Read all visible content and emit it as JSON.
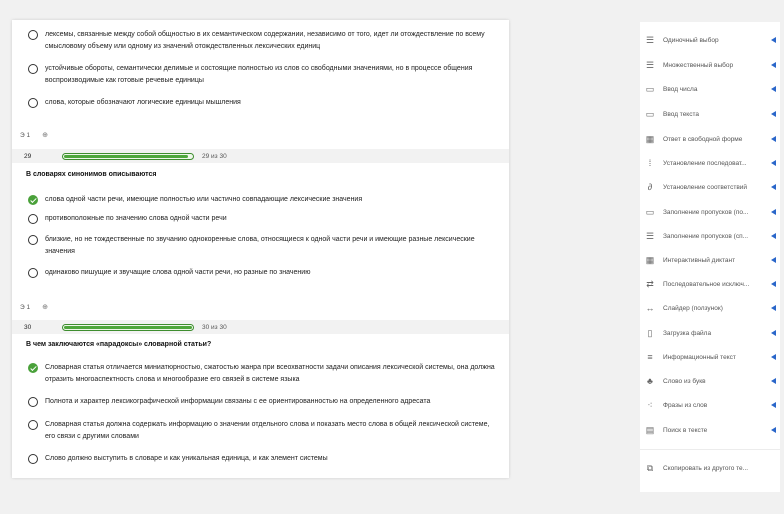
{
  "colors": {
    "accent_green": "#4ea63c",
    "arrow_blue": "#2a66c9"
  },
  "q1": {
    "options": [
      {
        "text": "лексемы, связанные между собой общностью в их семантическом содержании, независимо от того, идет ли отождествление по всему смысловому объему или одному из значений отождествленных лексических единиц",
        "checked": false
      },
      {
        "text": "устойчивые обороты, семантически делимые и состоящие полностью из слов со свободными значениями, но в процессе общения воспроизводимые как готовые речевые единицы",
        "checked": false
      },
      {
        "text": "слова, которые обозначают логические единицы мышления",
        "checked": false
      }
    ]
  },
  "q2": {
    "meta_left": "Э 1",
    "meta_right": "⊕",
    "score_num": "29",
    "score_text": "29 из 30",
    "progress": 0.967,
    "title": "В словарях синонимов описываются",
    "options": [
      {
        "text": "слова одной части речи, имеющие полностью или частично совпадающие лексические значения",
        "checked": true
      },
      {
        "text": "противоположные по значению слова одной части речи",
        "checked": false
      },
      {
        "text": "близкие, но не тождественные по звучанию однокоренные слова, относящиеся к одной части речи и имеющие разные лексические значения",
        "checked": false
      },
      {
        "text": "одинаково пишущие и звучащие слова одной части речи, но разные по значению",
        "checked": false
      }
    ]
  },
  "q3": {
    "meta_left": "Э 1",
    "meta_right": "⊕",
    "score_num": "30",
    "score_text": "30 из 30",
    "progress": 1.0,
    "title": "В чем заключаются «парадоксы» словарной статьи?",
    "options": [
      {
        "text": "Словарная статья отличается миниатюрностью, сжатостью жанра при всеохватности задачи описания лексической системы, она должна отразить многоаспектность слова и многообразие его связей в системе языка",
        "checked": true
      },
      {
        "text": "Полнота и характер лексикографической информации связаны с ее ориентированностью на определенного адресата",
        "checked": false
      },
      {
        "text": "Словарная статья должна содержать информацию о значении отдельного слова и показать место слова в общей лексической системе, его связи с другими словами",
        "checked": false
      },
      {
        "text": "Слово должно выступить в словаре и как уникальная единица, и как элемент системы",
        "checked": false
      }
    ]
  },
  "sidebar": {
    "items": [
      {
        "icon": "single-choice-icon",
        "label": "Одиночный выбор"
      },
      {
        "icon": "multiple-choice-icon",
        "label": "Множественный выбор"
      },
      {
        "icon": "number-input-icon",
        "label": "Ввод числа"
      },
      {
        "icon": "text-input-icon",
        "label": "Ввод текста"
      },
      {
        "icon": "free-answer-icon",
        "label": "Ответ в свободной форме"
      },
      {
        "icon": "ordering-icon",
        "label": "Установление последоват..."
      },
      {
        "icon": "matching-icon",
        "label": "Установление соответствий"
      },
      {
        "icon": "fill-gaps-icon",
        "label": "Заполнение пропусков (по..."
      },
      {
        "icon": "fill-gaps-list-icon",
        "label": "Заполнение пропусков (сп..."
      },
      {
        "icon": "interactive-diagram-icon",
        "label": "Интерактивный диктант"
      },
      {
        "icon": "sequential-exclusion-icon",
        "label": "Последовательное исключ..."
      },
      {
        "icon": "slider-icon",
        "label": "Слайдер (ползунок)"
      },
      {
        "icon": "file-upload-icon",
        "label": "Загрузка файла"
      },
      {
        "icon": "info-text-icon",
        "label": "Информационный текст"
      },
      {
        "icon": "words-from-letters-icon",
        "label": "Слово из букв"
      },
      {
        "icon": "phrases-from-words-icon",
        "label": "Фразы из слов"
      },
      {
        "icon": "text-search-icon",
        "label": "Поиск в тексте"
      }
    ],
    "copy_label": "Скопировать из другого те..."
  }
}
